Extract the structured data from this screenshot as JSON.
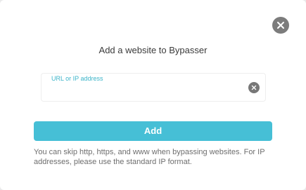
{
  "dialog": {
    "title": "Add a website to Bypasser",
    "close_icon": "close-icon",
    "input": {
      "label": "URL or IP address",
      "value": "",
      "placeholder": "",
      "clear_icon": "clear-icon"
    },
    "add_button_label": "Add",
    "help_text": "You can skip http, https, and www when bypassing websites. For IP addresses, please use the standard IP format."
  },
  "colors": {
    "accent": "#46bfd6",
    "label_accent": "#3bb4c9",
    "icon_gray": "#7c7c7c",
    "text_dark": "#3a3a3a",
    "text_muted": "#6e6e6e"
  }
}
